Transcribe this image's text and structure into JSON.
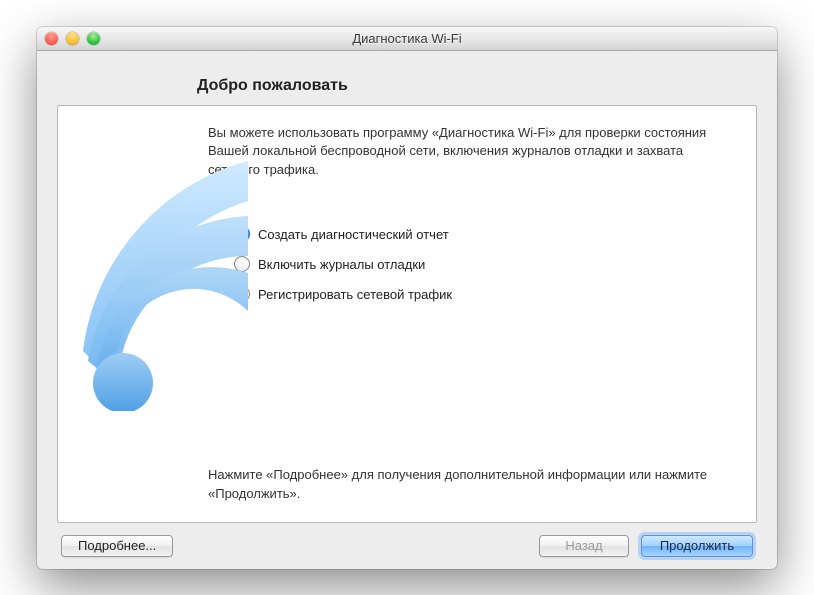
{
  "window": {
    "title": "Диагностика Wi-Fi"
  },
  "heading": "Добро пожаловать",
  "intro": "Вы можете использовать программу «Диагностика Wi-Fi» для проверки состояния Вашей локальной беспроводной сети, включения журналов отладки и захвата сетевого трафика.",
  "options": [
    {
      "label": "Создать диагностический отчет",
      "selected": true
    },
    {
      "label": "Включить журналы отладки",
      "selected": false
    },
    {
      "label": "Регистрировать сетевой трафик",
      "selected": false
    }
  ],
  "hint": "Нажмите «Подробнее» для получения дополнительной информации или нажмите «Продолжить».",
  "buttons": {
    "more": "Подробнее...",
    "back": "Назад",
    "continue": "Продолжить"
  }
}
